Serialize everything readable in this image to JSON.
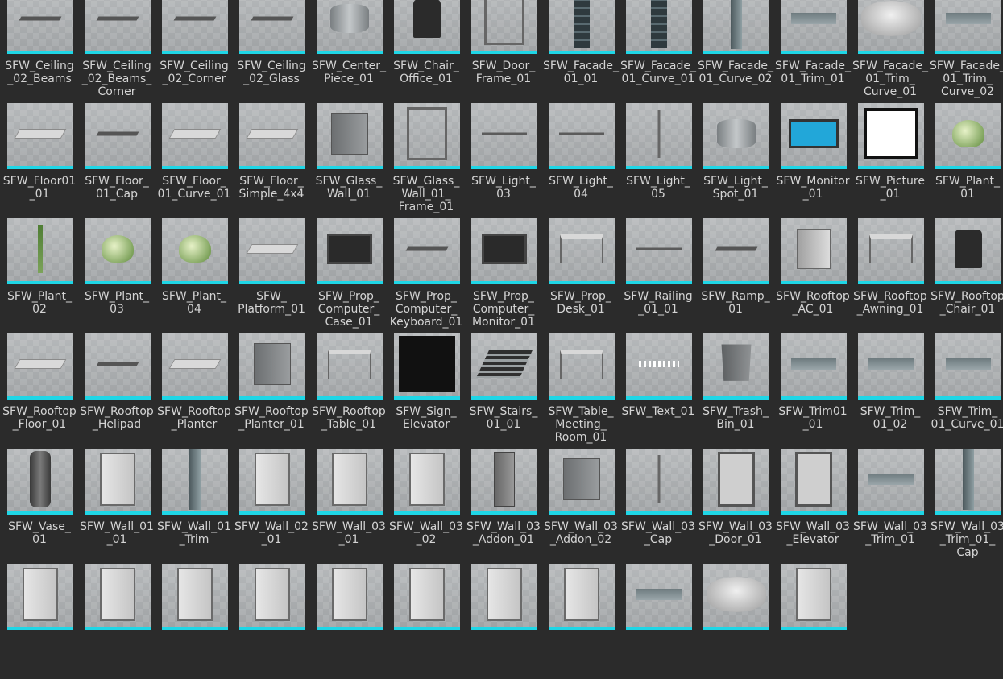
{
  "accent_color": "#1fd6e6",
  "assets": [
    {
      "label": "SFW_Ceiling\n_02_Beams",
      "icon": "s-flat"
    },
    {
      "label": "SFW_Ceiling\n_02_Beams_\nCorner",
      "icon": "s-flat"
    },
    {
      "label": "SFW_Ceiling\n_02_Corner",
      "icon": "s-flat"
    },
    {
      "label": "SFW_Ceiling\n_02_Glass",
      "icon": "s-flat"
    },
    {
      "label": "SFW_Center_\nPiece_01",
      "icon": "s-drum"
    },
    {
      "label": "SFW_Chair_\nOffice_01",
      "icon": "s-chair"
    },
    {
      "label": "SFW_Door_\nFrame_01",
      "icon": "s-frame"
    },
    {
      "label": "SFW_Facade_\n01_01",
      "icon": "s-column"
    },
    {
      "label": "SFW_Facade_\n01_Curve_01",
      "icon": "s-column"
    },
    {
      "label": "SFW_Facade_\n01_Curve_02",
      "icon": "s-tall"
    },
    {
      "label": "SFW_Facade_\n01_Trim_01",
      "icon": "s-trim"
    },
    {
      "label": "SFW_Facade_\n01_Trim_\nCurve_01",
      "icon": "s-ring"
    },
    {
      "label": "SFW_Facade_\n01_Trim_\nCurve_02",
      "icon": "s-trim"
    },
    {
      "label": "SFW_Floor01\n_01",
      "icon": "s-slab"
    },
    {
      "label": "SFW_Floor_\n01_Cap",
      "icon": "s-flat"
    },
    {
      "label": "SFW_Floor_\n01_Curve_01",
      "icon": "s-slab"
    },
    {
      "label": "SFW_Floor_\nSimple_4x4",
      "icon": "s-slab"
    },
    {
      "label": "SFW_Glass_\nWall_01",
      "icon": "s-box"
    },
    {
      "label": "SFW_Glass_\nWall_01_\nFrame_01",
      "icon": "s-frame"
    },
    {
      "label": "SFW_Light_\n03",
      "icon": "s-line"
    },
    {
      "label": "SFW_Light_\n04",
      "icon": "s-line"
    },
    {
      "label": "SFW_Light_\n05",
      "icon": "s-post"
    },
    {
      "label": "SFW_Light_\nSpot_01",
      "icon": "s-drum"
    },
    {
      "label": "SFW_Monitor\n_01",
      "icon": "s-monitor"
    },
    {
      "label": "SFW_Picture\n_01",
      "icon": "s-picture"
    },
    {
      "label": "SFW_Plant_\n01",
      "icon": "s-plant"
    },
    {
      "label": "SFW_Plant_\n02",
      "icon": "s-stem"
    },
    {
      "label": "SFW_Plant_\n03",
      "icon": "s-plant"
    },
    {
      "label": "SFW_Plant_\n04",
      "icon": "s-plant"
    },
    {
      "label": "SFW_\nPlatform_01",
      "icon": "s-slab"
    },
    {
      "label": "SFW_Prop_\nComputer_\nCase_01",
      "icon": "s-screen"
    },
    {
      "label": "SFW_Prop_\nComputer_\nKeyboard_01",
      "icon": "s-flat"
    },
    {
      "label": "SFW_Prop_\nComputer_\nMonitor_01",
      "icon": "s-screen"
    },
    {
      "label": "SFW_Prop_\nDesk_01",
      "icon": "s-table"
    },
    {
      "label": "SFW_Railing\n_01_01",
      "icon": "s-line"
    },
    {
      "label": "SFW_Ramp_\n01",
      "icon": "s-flat"
    },
    {
      "label": "SFW_Rooftop\n_AC_01",
      "icon": "s-ac"
    },
    {
      "label": "SFW_Rooftop\n_Awning_01",
      "icon": "s-table"
    },
    {
      "label": "SFW_Rooftop\n_Chair_01",
      "icon": "s-chair"
    },
    {
      "label": "SFW_Rooftop\n_Floor_01",
      "icon": "s-slab"
    },
    {
      "label": "SFW_Rooftop\n_Helipad",
      "icon": "s-flat"
    },
    {
      "label": "SFW_Rooftop\n_Planter",
      "icon": "s-slab"
    },
    {
      "label": "SFW_Rooftop\n_Planter_01",
      "icon": "s-box"
    },
    {
      "label": "SFW_Rooftop\n_Table_01",
      "icon": "s-table"
    },
    {
      "label": "SFW_Sign_\nElevator",
      "icon": "s-sign"
    },
    {
      "label": "SFW_Stairs_\n01_01",
      "icon": "s-stairs"
    },
    {
      "label": "SFW_Table_\nMeeting_\nRoom_01",
      "icon": "s-table"
    },
    {
      "label": "SFW_Text_01",
      "icon": "s-text"
    },
    {
      "label": "SFW_Trash_\nBin_01",
      "icon": "s-bin"
    },
    {
      "label": "SFW_Trim01\n_01",
      "icon": "s-trim"
    },
    {
      "label": "SFW_Trim_\n01_02",
      "icon": "s-trim"
    },
    {
      "label": "SFW_Trim_\n01_Curve_01",
      "icon": "s-trim"
    },
    {
      "label": "SFW_Vase_\n01",
      "icon": "s-vase"
    },
    {
      "label": "SFW_Wall_01\n_01",
      "icon": "s-panel"
    },
    {
      "label": "SFW_Wall_01\n_Trim",
      "icon": "s-tall"
    },
    {
      "label": "SFW_Wall_02\n_01",
      "icon": "s-panel"
    },
    {
      "label": "SFW_Wall_03\n_01",
      "icon": "s-panel"
    },
    {
      "label": "SFW_Wall_03\n_02",
      "icon": "s-panel"
    },
    {
      "label": "SFW_Wall_03\n_Addon_01",
      "icon": "s-addon"
    },
    {
      "label": "SFW_Wall_03\n_Addon_02",
      "icon": "s-box"
    },
    {
      "label": "SFW_Wall_03\n_Cap",
      "icon": "s-post"
    },
    {
      "label": "SFW_Wall_03\n_Door_01",
      "icon": "s-elevator"
    },
    {
      "label": "SFW_Wall_03\n_Elevator",
      "icon": "s-elevator"
    },
    {
      "label": "SFW_Wall_03\n_Trim_01",
      "icon": "s-trim"
    },
    {
      "label": "SFW_Wall_03\n_Trim_01_\nCap",
      "icon": "s-tall"
    },
    {
      "label": "",
      "icon": "s-panel"
    },
    {
      "label": "",
      "icon": "s-panel"
    },
    {
      "label": "",
      "icon": "s-panel"
    },
    {
      "label": "",
      "icon": "s-panel"
    },
    {
      "label": "",
      "icon": "s-panel"
    },
    {
      "label": "",
      "icon": "s-panel"
    },
    {
      "label": "",
      "icon": "s-panel"
    },
    {
      "label": "",
      "icon": "s-panel"
    },
    {
      "label": "",
      "icon": "s-trim"
    },
    {
      "label": "",
      "icon": "s-ring"
    },
    {
      "label": "",
      "icon": "s-panel"
    }
  ]
}
